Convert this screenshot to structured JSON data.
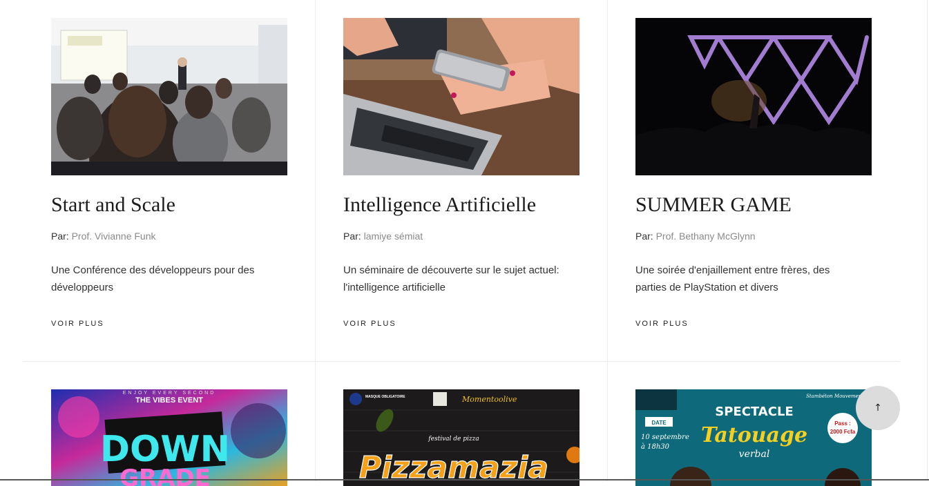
{
  "events": [
    {
      "title": "Start and Scale",
      "author_prefix": "Par:",
      "author_name": "Prof. Vivianne Funk",
      "description": "Une Conférence des développeurs pour des développeurs",
      "more_label": "VOIR PLUS"
    },
    {
      "title": "Intelligence Artificielle",
      "author_prefix": "Par:",
      "author_name": "lamiye sémiat",
      "description": "Un séminaire de découverte sur le sujet actuel: l'intelligence artificielle",
      "more_label": "VOIR PLUS"
    },
    {
      "title": "SUMMER GAME",
      "author_prefix": "Par:",
      "author_name": "Prof. Bethany McGlynn",
      "description": "Une soirée d'enjaillement entre frères, des parties de PlayStation et divers",
      "more_label": "VOIR PLUS"
    }
  ],
  "posters": [
    {
      "top_text": "ENJOY EVERY SECOND",
      "subtitle": "THE VIBES EVENT",
      "headline": "DOWN",
      "headline2": "GRADE"
    },
    {
      "badge": "MASQUE OBLIGATOIRE",
      "brand": "Momentoolive",
      "kicker": "festival de pizza",
      "headline": "Pizzamazia"
    },
    {
      "corner": "Stambéton Mouvement",
      "label": "DATE",
      "date": "10 septembre",
      "time": "à 18h30",
      "headline": "SPECTACLE",
      "headline2": "Tatouage",
      "headline3": "verbal",
      "pass_label": "Pass :",
      "pass_price": "2000 Fcfa"
    }
  ],
  "scroll_top": {
    "icon": "arrow-up-icon",
    "glyph": "↑"
  },
  "colors": {
    "text": "#333333",
    "muted": "#8a8a8a",
    "title": "#1b1b1b",
    "button_bg": "#dcdcdc"
  }
}
